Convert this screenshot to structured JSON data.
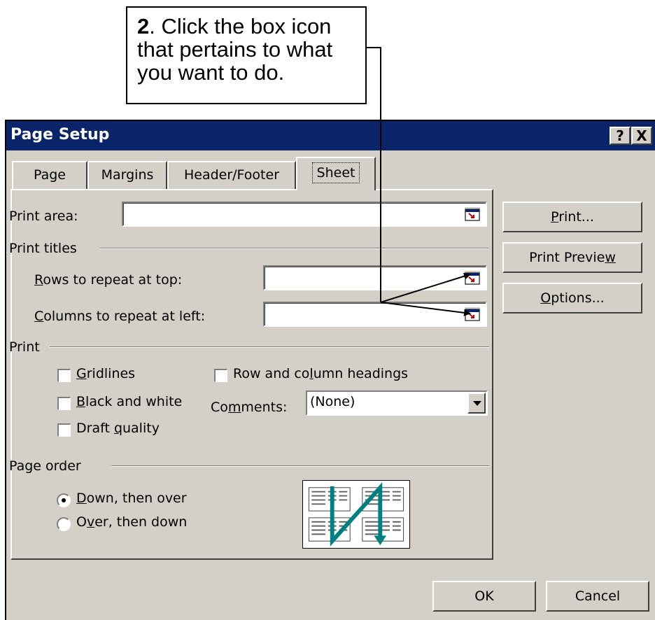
{
  "callout": {
    "step": "2",
    "text": ". Click the box icon that pertains to what you want to do."
  },
  "dialog": {
    "title": "Page Setup",
    "help_button": "?",
    "close_button": "X",
    "tabs": [
      "Page",
      "Margins",
      "Header/Footer",
      "Sheet"
    ],
    "active_tab": "Sheet",
    "print_area_label": "Print area:",
    "print_titles_label": "Print titles",
    "rows_label": "Rows to repeat at top:",
    "columns_label": "Columns to repeat at left:",
    "print_group_label": "Print",
    "checkboxes": {
      "gridlines": "Gridlines",
      "black_white": "Black and white",
      "draft": "Draft quality",
      "headings": "Row and column headings"
    },
    "comments_label": "Comments:",
    "comments_value": "(None)",
    "page_order_label": "Page order",
    "radio_down": "Down, then over",
    "radio_over": "Over, then down",
    "selected_order": "Down, then over",
    "buttons": {
      "print": "Print...",
      "print_preview": "Print Preview",
      "options": "Options...",
      "ok": "OK",
      "cancel": "Cancel"
    }
  },
  "colors": {
    "titlebar": "#0a246a",
    "dialog_face": "#d4d0c8",
    "arrow_teal": "#008080"
  }
}
